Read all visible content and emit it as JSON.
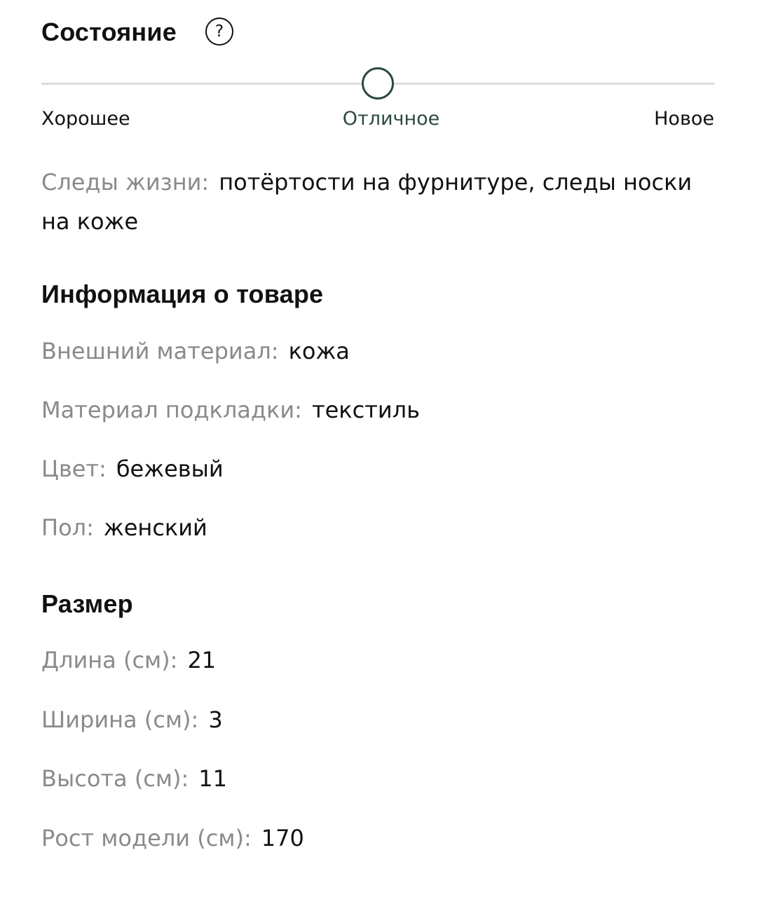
{
  "colors": {
    "accent": "#2c4a3a",
    "text_primary": "#111111",
    "text_secondary": "#8a8a8a",
    "track": "#dcdcdc"
  },
  "condition": {
    "title": "Состояние",
    "help_icon": "question-circle-icon",
    "help_symbol": "?",
    "level": 0.5,
    "levels": [
      "Хорошее",
      "Отличное",
      "Новое"
    ],
    "selected": "Отличное"
  },
  "wear": {
    "label": "Следы жизни",
    "value": "потёртости на фурнитуре, следы носки на коже"
  },
  "product_info": {
    "title": "Информация о товаре",
    "items": [
      {
        "label": "Внешний материал",
        "value": "кожа"
      },
      {
        "label": "Материал подкладки",
        "value": "текстиль"
      },
      {
        "label": "Цвет",
        "value": "бежевый"
      },
      {
        "label": "Пол",
        "value": "женский"
      }
    ]
  },
  "size": {
    "title": "Размер",
    "items": [
      {
        "label": "Длина (см)",
        "value": "21"
      },
      {
        "label": "Ширина (см)",
        "value": "3"
      },
      {
        "label": "Высота (см)",
        "value": "11"
      },
      {
        "label": "Рост модели (см)",
        "value": "170"
      }
    ]
  }
}
